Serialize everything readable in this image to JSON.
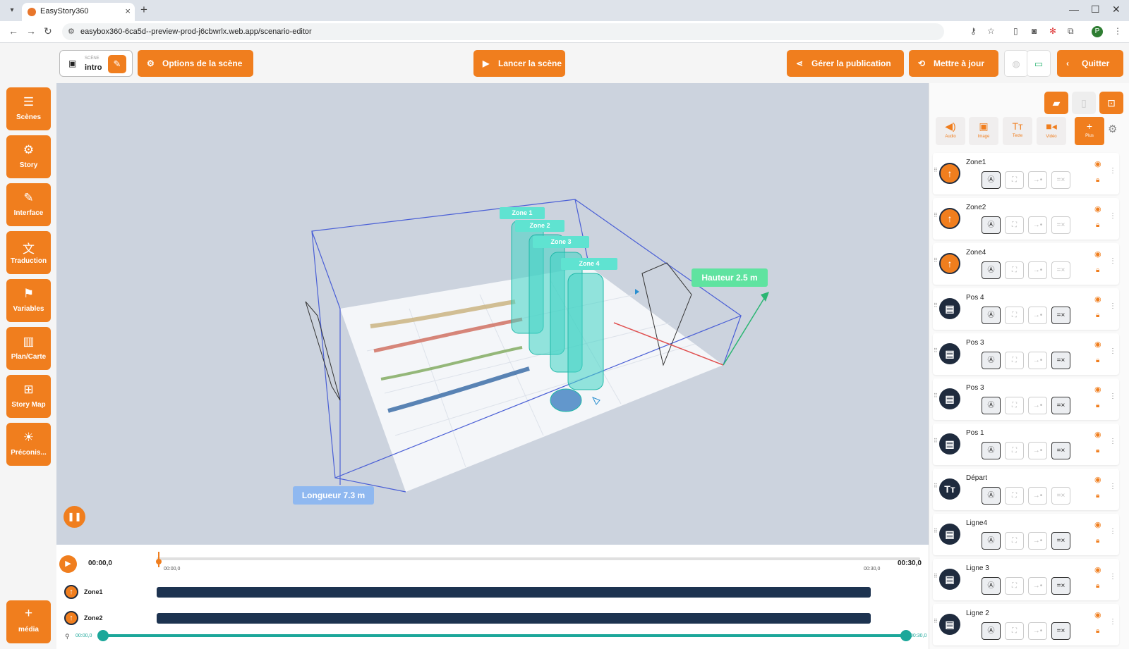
{
  "browser": {
    "tab_title": "EasyStory360",
    "url": "easybox360-6ca5d--preview-prod-j6cbwrlx.web.app/scenario-editor",
    "profile_initial": "P"
  },
  "topbar": {
    "scene_label": "SCÈNE",
    "scene_name": "intro",
    "options_label": "Options de la scène",
    "launch_label": "Lancer la scène",
    "publish_label": "Gérer la publication",
    "update_label": "Mettre à jour",
    "quit_label": "Quitter"
  },
  "sidebar": {
    "items": [
      {
        "label": "Scènes",
        "icon": "menu-icon"
      },
      {
        "label": "Story",
        "icon": "gear-icon"
      },
      {
        "label": "Interface",
        "icon": "brush-icon"
      },
      {
        "label": "Traduction",
        "icon": "translate-icon"
      },
      {
        "label": "Variables",
        "icon": "bookmark-icon"
      },
      {
        "label": "Plan/Carte",
        "icon": "map-icon"
      },
      {
        "label": "Story Map",
        "icon": "tree-icon"
      },
      {
        "label": "Préconis...",
        "icon": "bulb-icon"
      }
    ],
    "add_media": "média"
  },
  "viewport": {
    "zones": [
      "Zone 1",
      "Zone 2",
      "Zone 3",
      "Zone 4"
    ],
    "height_label": "Hauteur 2.5 m",
    "length_label": "Longueur 7.3 m",
    "colors": {
      "zone": "#5fe3d1",
      "height_tag": "#5fe3a0",
      "length_tag": "#8fb8f0",
      "box": "#4a5fd6"
    }
  },
  "timeline": {
    "current_time": "00:00,0",
    "end_time": "00:30,0",
    "ruler_start": "00:00,0",
    "ruler_end": "00:30,0",
    "zoom_start": "00:00,0",
    "zoom_end": "00:30,0",
    "tracks": [
      {
        "name": "Zone1"
      },
      {
        "name": "Zone2"
      }
    ]
  },
  "media_panel": {
    "types": [
      {
        "label": "Audio",
        "icon": "speaker-icon"
      },
      {
        "label": "Image",
        "icon": "image-icon"
      },
      {
        "label": "Texte",
        "icon": "text-icon"
      },
      {
        "label": "Vidéo",
        "icon": "video-icon"
      },
      {
        "label": "Plus",
        "icon": "plus-icon"
      }
    ],
    "items": [
      {
        "name": "Zone1",
        "kind": "zone"
      },
      {
        "name": "Zone2",
        "kind": "zone"
      },
      {
        "name": "Zone4",
        "kind": "zone"
      },
      {
        "name": "Pos 4",
        "kind": "image"
      },
      {
        "name": "Pos 3",
        "kind": "image"
      },
      {
        "name": "Pos 3",
        "kind": "image"
      },
      {
        "name": "Pos 1",
        "kind": "image"
      },
      {
        "name": "Départ",
        "kind": "text"
      },
      {
        "name": "Ligne4",
        "kind": "image"
      },
      {
        "name": "Ligne 3",
        "kind": "image"
      },
      {
        "name": "Ligne 2",
        "kind": "image"
      }
    ]
  }
}
